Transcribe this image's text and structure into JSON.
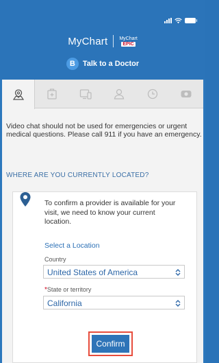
{
  "header": {
    "brand_name": "MyChart",
    "brand_sub_top": "MyChart",
    "brand_sub_bottom": "EPIC",
    "talk_badge": "B",
    "talk_label": "Talk to a Doctor"
  },
  "tabs": [
    {
      "icon": "map-location-icon",
      "active": true
    },
    {
      "icon": "medical-kit-icon",
      "active": false
    },
    {
      "icon": "devices-icon",
      "active": false
    },
    {
      "icon": "person-icon",
      "active": false
    },
    {
      "icon": "clock-icon",
      "active": false
    },
    {
      "icon": "video-camera-icon",
      "active": false
    }
  ],
  "notice": "Video chat should not be used for emergencies or urgent medical questions.  Please call 911 if you have an emergency.",
  "location_header": "WHERE ARE YOU CURRENTLY LOCATED?",
  "card": {
    "text": "To confirm a provider is available for your visit, we need to know your current location.",
    "select_link": "Select a Location",
    "country_label": "Country",
    "country_value": "United States of America",
    "state_required_mark": "*",
    "state_label": "State or territory",
    "state_value": "California",
    "confirm_label": "Confirm"
  },
  "colors": {
    "header_blue": "#2b74b9",
    "link_blue": "#2a6fb5",
    "highlight_red": "#e74c3c"
  }
}
